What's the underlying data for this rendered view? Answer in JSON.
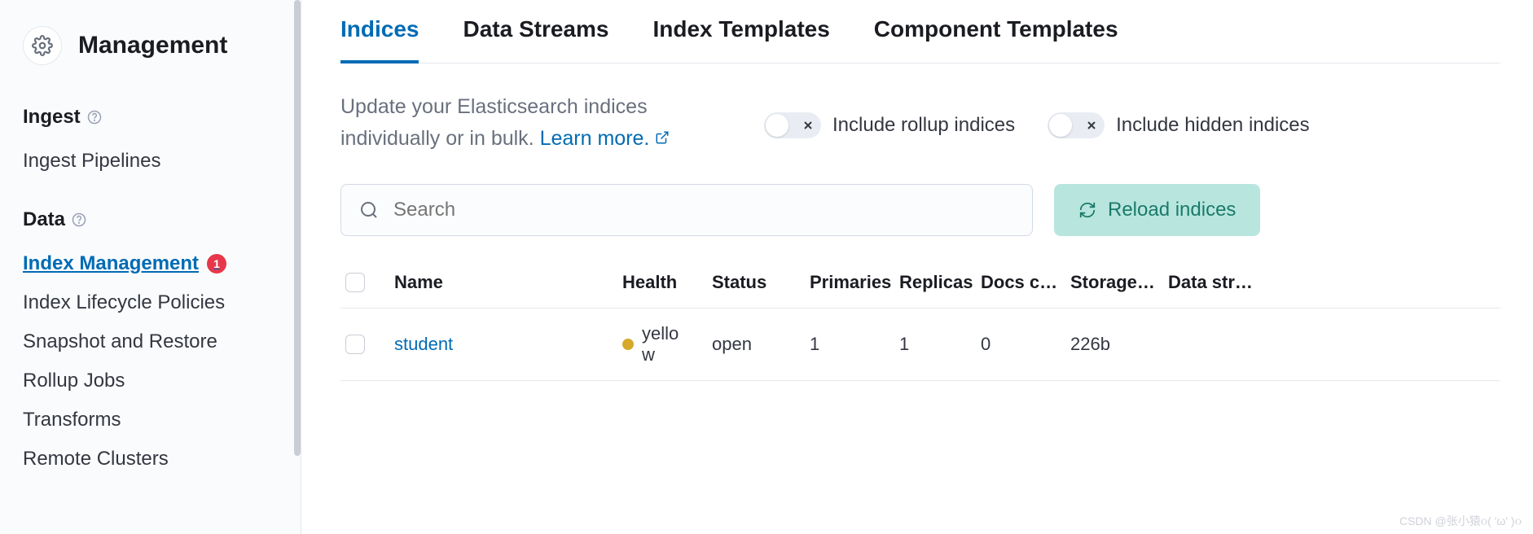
{
  "sidebar": {
    "title": "Management",
    "sections": [
      {
        "label": "Ingest",
        "items": [
          "Ingest Pipelines"
        ]
      },
      {
        "label": "Data",
        "items": [
          "Index Management",
          "Index Lifecycle Policies",
          "Snapshot and Restore",
          "Rollup Jobs",
          "Transforms",
          "Remote Clusters"
        ]
      }
    ],
    "active_item": "Index Management",
    "badge_count": "1"
  },
  "tabs": [
    "Indices",
    "Data Streams",
    "Index Templates",
    "Component Templates"
  ],
  "active_tab": "Indices",
  "intro_text": "Update your Elasticsearch indices individually or in bulk. ",
  "learn_more": "Learn more.",
  "toggles": {
    "rollup": "Include rollup indices",
    "hidden": "Include hidden indices"
  },
  "search_placeholder": "Search",
  "reload_label": "Reload indices",
  "columns": [
    "Name",
    "Health",
    "Status",
    "Primaries",
    "Replicas",
    "Docs c…",
    "Storage…",
    "Data str…"
  ],
  "rows": [
    {
      "name": "student",
      "health": "yellow",
      "status": "open",
      "primaries": "1",
      "replicas": "1",
      "docs": "0",
      "storage": "226b",
      "datastream": ""
    }
  ],
  "watermark": "CSDN @张小猿૦( 'ω' )૦"
}
